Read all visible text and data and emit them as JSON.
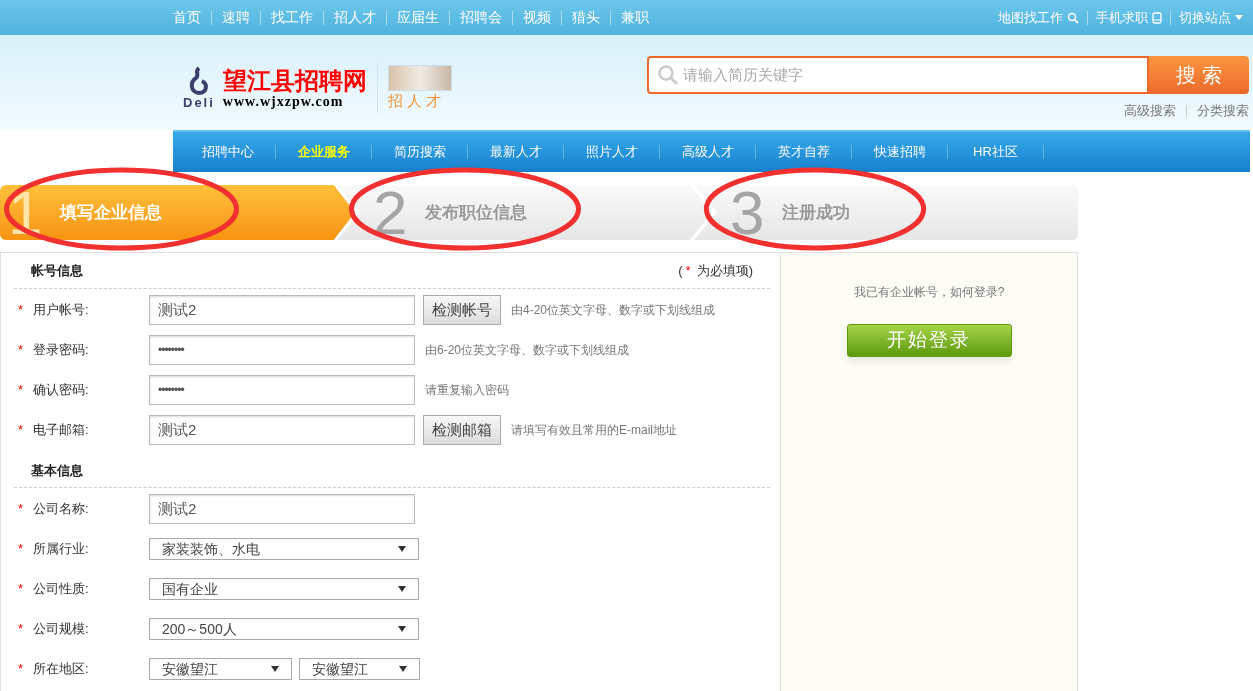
{
  "top_nav": {
    "items": [
      {
        "label": "首页"
      },
      {
        "label": "速聘"
      },
      {
        "label": "找工作"
      },
      {
        "label": "招人才"
      },
      {
        "label": "应届生"
      },
      {
        "label": "招聘会"
      },
      {
        "label": "视频"
      },
      {
        "label": "猎头"
      },
      {
        "label": "兼职"
      }
    ]
  },
  "top_links": [
    {
      "label": "地图找工作",
      "kind": "map"
    },
    {
      "label": "手机求职",
      "kind": "phone"
    },
    {
      "label": "切换站点",
      "kind": "dropdown"
    }
  ],
  "logo": {
    "name": "望江县招聘网",
    "url": "www.wjxzpw.com",
    "brand": "Deli",
    "tag": "招人才"
  },
  "search": {
    "placeholder": "请输入简历关键字",
    "button": "搜 索",
    "links": [
      "高级搜索",
      "分类搜索"
    ]
  },
  "main_nav": {
    "items": [
      {
        "label": "招聘中心",
        "selected": false
      },
      {
        "label": "企业服务",
        "selected": true
      },
      {
        "label": "简历搜索",
        "selected": false
      },
      {
        "label": "最新人才",
        "selected": false
      },
      {
        "label": "照片人才",
        "selected": false
      },
      {
        "label": "高级人才",
        "selected": false
      },
      {
        "label": "英才自荐",
        "selected": false
      },
      {
        "label": "快速招聘",
        "selected": false
      },
      {
        "label": "HR社区",
        "selected": false
      }
    ]
  },
  "steps": [
    {
      "number": "1",
      "label": "填写企业信息",
      "selected": true
    },
    {
      "number": "2",
      "label": "发布职位信息",
      "selected": false
    },
    {
      "number": "3",
      "label": "注册成功",
      "selected": false
    }
  ],
  "account_section": {
    "title": "帐号信息",
    "required_note": {
      "open": "(",
      "star": "*",
      "text": "为必填项)"
    },
    "fields": [
      {
        "kind": "text",
        "star": "*",
        "label": "用户帐号:",
        "value": "测试2",
        "button": "检测帐号",
        "hint": "由4-20位英文字母、数字或下划线组成"
      },
      {
        "kind": "password",
        "star": "*",
        "label": "登录密码:",
        "value": "••••••••",
        "hint": "由6-20位英文字母、数字或下划线组成"
      },
      {
        "kind": "password",
        "star": "*",
        "label": "确认密码:",
        "value": "••••••••",
        "hint": "请重复输入密码"
      },
      {
        "kind": "text",
        "star": "*",
        "label": "电子邮箱:",
        "value": "测试2",
        "button": "检测邮箱",
        "hint": "请填写有效且常用的E-mail地址"
      }
    ]
  },
  "basic_section": {
    "title": "基本信息",
    "fields": [
      {
        "kind": "text",
        "star": "*",
        "label": "公司名称:",
        "value": "测试2"
      },
      {
        "kind": "select",
        "star": "*",
        "label": "所属行业:",
        "values": [
          "家装装饰、水电"
        ]
      },
      {
        "kind": "select",
        "star": "*",
        "label": "公司性质:",
        "values": [
          "国有企业"
        ]
      },
      {
        "kind": "select",
        "star": "*",
        "label": "公司规模:",
        "values": [
          "200～500人"
        ]
      },
      {
        "kind": "select_pair",
        "star": "*",
        "label": "所在地区:",
        "values": [
          "安徽望江",
          "安徽望江"
        ]
      }
    ]
  },
  "sidebar": {
    "question": "我已有企业帐号，如何登录?",
    "button": "开始登录"
  },
  "annotations": [
    {
      "kind": "ellipse"
    },
    {
      "kind": "ellipse"
    },
    {
      "kind": "ellipse"
    }
  ]
}
